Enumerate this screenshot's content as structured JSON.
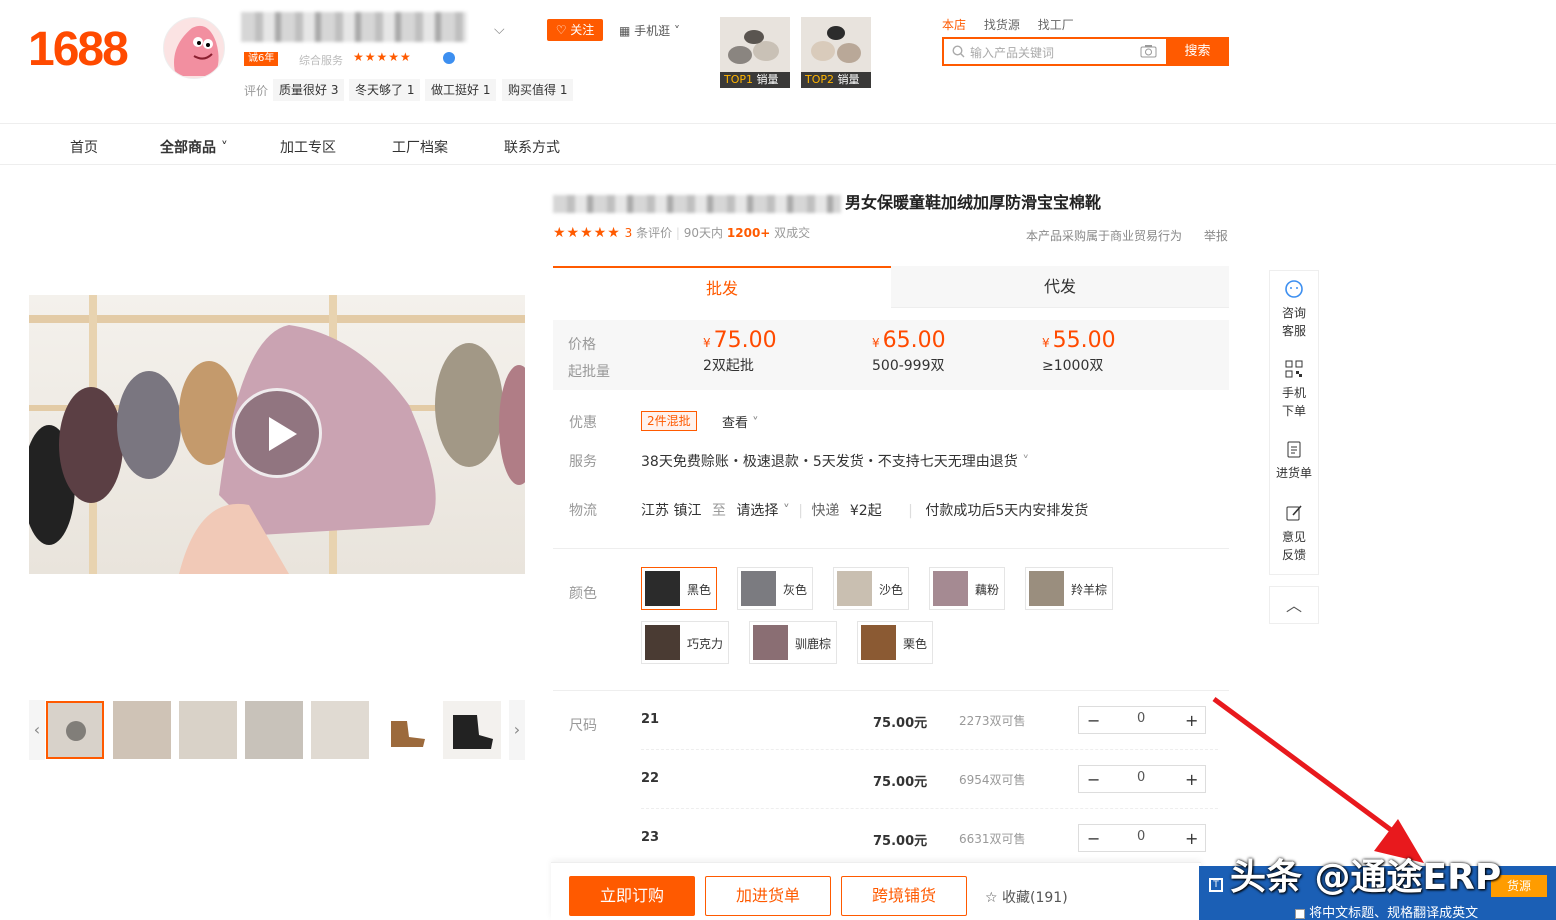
{
  "header": {
    "logo": "1688",
    "badge": "诚6年",
    "service_label": "综合服务",
    "stars": "★★★★★",
    "follow": "关注",
    "mobile": "手机逛",
    "reviews_label": "评价",
    "review_tags": [
      "质量很好 3",
      "冬天够了 1",
      "做工挺好 1",
      "购买值得 1"
    ],
    "top_thumbs": [
      {
        "rank": "TOP1",
        "label": "销量"
      },
      {
        "rank": "TOP2",
        "label": "销量"
      }
    ],
    "search_tabs": [
      "本店",
      "找货源",
      "找工厂"
    ],
    "search_placeholder": "输入产品关键词",
    "search_button": "搜索"
  },
  "nav": {
    "items": [
      "首页",
      "全部商品",
      "加工专区",
      "工厂档案",
      "联系方式"
    ]
  },
  "product": {
    "title": "男女保暖童鞋加绒加厚防滑宝宝棉靴",
    "rating_stars": "★★★★★",
    "review_count": "3",
    "review_unit": "条评价",
    "sold_period": "90天内",
    "sold_count": "1200+",
    "sold_unit": "双成交",
    "trade_note": "本产品采购属于商业贸易行为",
    "report": "举报",
    "tabs": [
      "批发",
      "代发"
    ],
    "price_label": "价格",
    "moq_label": "起批量",
    "currency": "¥",
    "tiers": [
      {
        "price": "75.00",
        "qty": "2双起批"
      },
      {
        "price": "65.00",
        "qty": "500-999双"
      },
      {
        "price": "55.00",
        "qty": "≥1000双"
      }
    ],
    "promo_label": "优惠",
    "promo_tag": "2件混批",
    "promo_view": "查看",
    "service_label": "服务",
    "service_text": "38天免费赊账・极速退款・5天发货・不支持七天无理由退货",
    "logistics_label": "物流",
    "origin": "江苏 镇江",
    "to": "至",
    "dest": "请选择",
    "express": "快递",
    "express_fee": "¥2起",
    "ship_note": "付款成功后5天内安排发货",
    "color_label": "颜色",
    "colors": [
      "黑色",
      "灰色",
      "沙色",
      "藕粉",
      "羚羊棕",
      "巧克力",
      "驯鹿棕",
      "栗色"
    ],
    "size_label": "尺码",
    "sizes": [
      {
        "size": "21",
        "price": "75.00元",
        "stock": "2273双可售",
        "qty": "0"
      },
      {
        "size": "22",
        "price": "75.00元",
        "stock": "6954双可售",
        "qty": "0"
      },
      {
        "size": "23",
        "price": "75.00元",
        "stock": "6631双可售",
        "qty": "0"
      }
    ]
  },
  "actions": {
    "buy": "立即订购",
    "cart": "加进货单",
    "crossborder": "跨境铺货",
    "favorite": "收藏(191)"
  },
  "sidebar": {
    "items": [
      "咨询客服",
      "手机下单",
      "进货单",
      "意见反馈"
    ]
  },
  "erp": {
    "button": "货源",
    "checkbox_label": "将中文标题、规格翻译成英文"
  },
  "watermark": "头条 @通途ERP",
  "colors": {
    "accent": "#ff5a00",
    "erp_blue": "#1b5fb5"
  }
}
